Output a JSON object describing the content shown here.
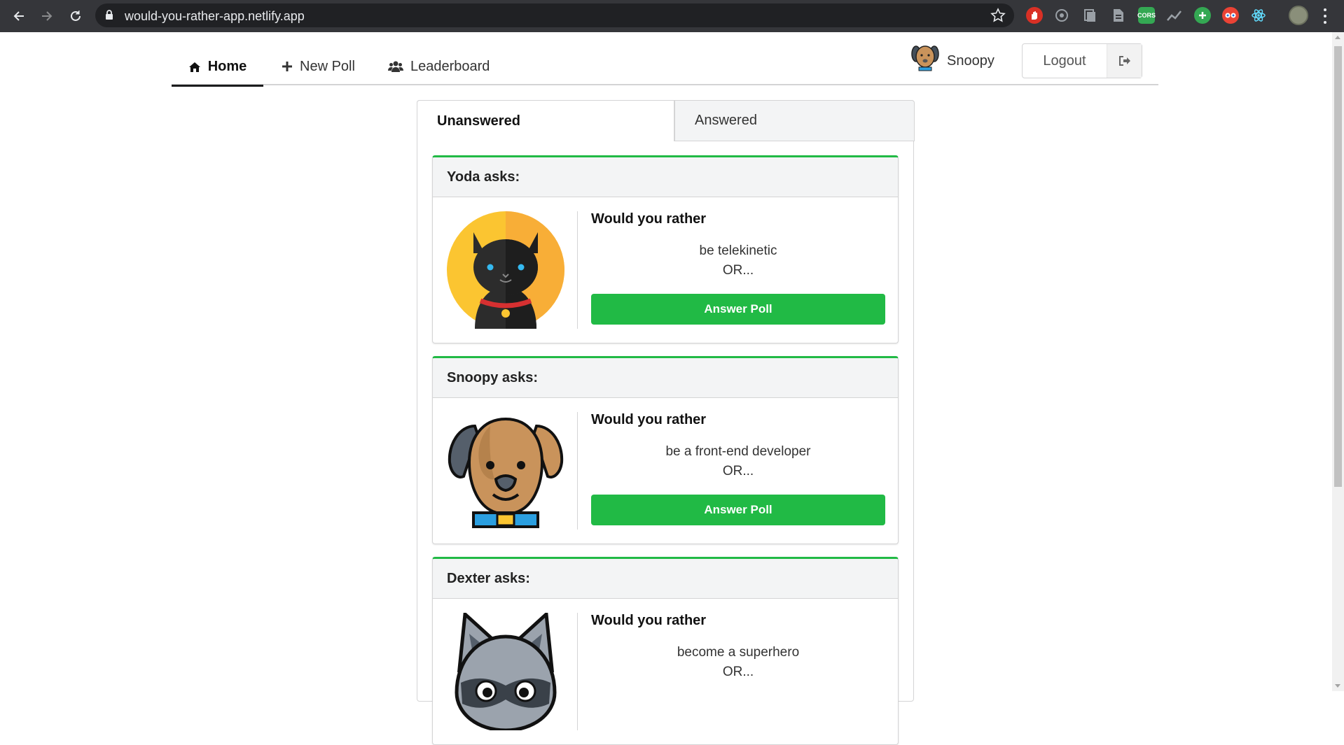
{
  "browser": {
    "url": "would-you-rather-app.netlify.app",
    "extensions": [
      {
        "icon": "adblock-icon",
        "color": "#d93025"
      },
      {
        "icon": "podcast-icon",
        "color": "#9aa0a6"
      },
      {
        "icon": "pages-icon",
        "color": "#9aa0a6"
      },
      {
        "icon": "docs-icon",
        "color": "#9aa0a6"
      },
      {
        "icon": "cors-icon",
        "color": "#34a853",
        "label": "CORS"
      },
      {
        "icon": "stats-icon",
        "color": "#9aa0a6"
      },
      {
        "icon": "plus-extension-icon",
        "color": "#34a853"
      },
      {
        "icon": "glasses-icon",
        "color": "#ea4335"
      },
      {
        "icon": "react-icon",
        "color": "#61dafb"
      }
    ]
  },
  "nav": {
    "home": "Home",
    "new_poll": "New Poll",
    "leaderboard": "Leaderboard",
    "user_name": "Snoopy",
    "logout": "Logout"
  },
  "tabs": {
    "unanswered": "Unanswered",
    "answered": "Answered"
  },
  "questions": [
    {
      "author": "Yoda asks:",
      "avatar": "cat-avatar",
      "title": "Would you rather",
      "option": "be telekinetic",
      "or": "OR...",
      "button": "Answer Poll"
    },
    {
      "author": "Snoopy asks:",
      "avatar": "dog-avatar",
      "title": "Would you rather",
      "option": "be a front-end developer",
      "or": "OR...",
      "button": "Answer Poll"
    },
    {
      "author": "Dexter asks:",
      "avatar": "raccoon-avatar",
      "title": "Would you rather",
      "option": "become a superhero",
      "or": "OR..."
    }
  ],
  "colors": {
    "accent_green": "#21ba45",
    "chrome_bar": "#35363a"
  }
}
